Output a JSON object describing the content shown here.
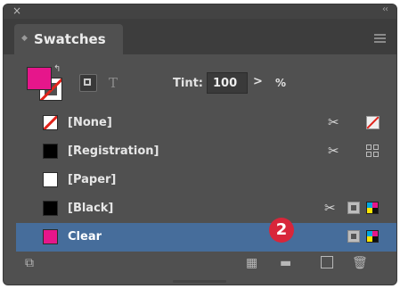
{
  "titlebar": {
    "close_glyph": "×",
    "collapse_glyph": "‹‹"
  },
  "panel": {
    "tab_title": "Swatches",
    "menu_icon": "panel-menu-icon"
  },
  "controls": {
    "tint_label": "Tint:",
    "tint_value": "100",
    "tint_arrow": ">",
    "tint_unit": "%",
    "text_icon_glyph": "T",
    "swap_glyph": "↰"
  },
  "swatches": [
    {
      "name": "[None]",
      "selected": false,
      "color": "none"
    },
    {
      "name": "[Registration]",
      "selected": false,
      "color": "#000000"
    },
    {
      "name": "[Paper]",
      "selected": false,
      "color": "#ffffff"
    },
    {
      "name": "[Black]",
      "selected": false,
      "color": "#000000"
    },
    {
      "name": "Clear",
      "selected": true,
      "color": "#e6168b"
    }
  ],
  "noedit_glyph": "✂",
  "badge": {
    "label": "2"
  },
  "colors": {
    "accent_fill": "#e6168b",
    "selection": "#466d9b",
    "badge": "#d8263a"
  }
}
